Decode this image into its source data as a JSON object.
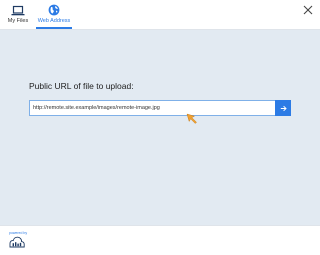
{
  "tabs": [
    {
      "label": "My Files",
      "icon": "laptop-icon",
      "active": false
    },
    {
      "label": "Web Address",
      "icon": "globe-icon",
      "active": true
    }
  ],
  "main": {
    "prompt": "Public URL of file to upload:",
    "url_value": "http://remote.site.example/images/remote-image.jpg"
  },
  "footer": {
    "powered_by": "powered by",
    "logo": "filestack-logo"
  },
  "colors": {
    "accent": "#2c7be5",
    "panel_bg": "#e2eaf2",
    "cursor": "#f0a030"
  }
}
